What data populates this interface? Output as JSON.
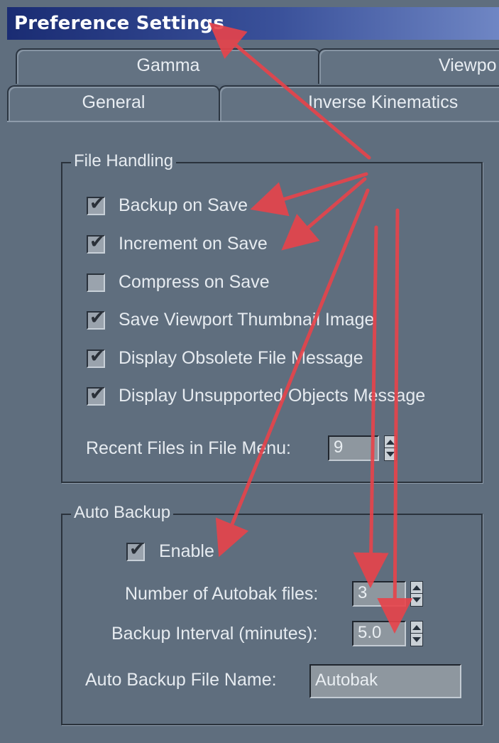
{
  "window": {
    "title": "Preference Settings"
  },
  "tabs": {
    "row1": [
      "Gamma",
      "Viewpo"
    ],
    "row2": [
      "General",
      "Inverse Kinematics"
    ]
  },
  "file_handling": {
    "legend": "File Handling",
    "options": [
      {
        "label": "Backup on Save",
        "checked": true
      },
      {
        "label": "Increment on Save",
        "checked": true
      },
      {
        "label": "Compress on Save",
        "checked": false
      },
      {
        "label": "Save Viewport Thumbnail Image",
        "checked": true
      },
      {
        "label": "Display Obsolete File Message",
        "checked": true
      },
      {
        "label": "Display Unsupported Objects Message",
        "checked": true
      }
    ],
    "recent_files_label": "Recent Files in File Menu:",
    "recent_files_value": "9"
  },
  "auto_backup": {
    "legend": "Auto Backup",
    "enable_label": "Enable",
    "enable_checked": true,
    "num_files_label": "Number of Autobak files:",
    "num_files_value": "3",
    "interval_label": "Backup Interval (minutes):",
    "interval_value": "5.0",
    "filename_label": "Auto Backup File Name:",
    "filename_value": "Autobak"
  },
  "colors": {
    "annotation_arrow": "#e8434a"
  }
}
